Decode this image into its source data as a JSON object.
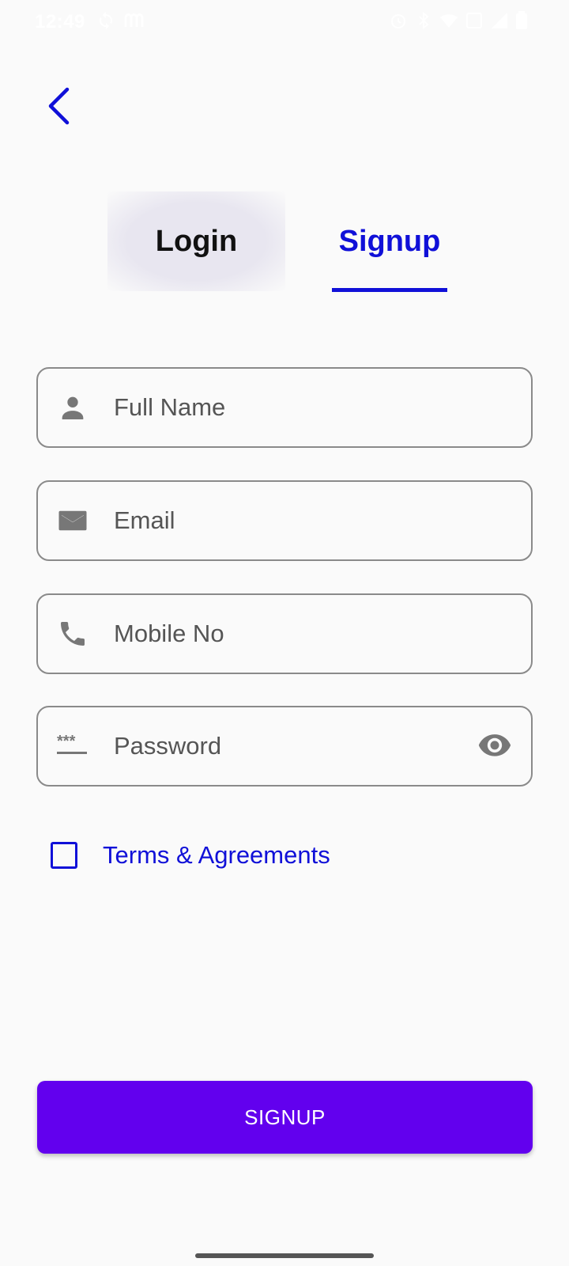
{
  "status_bar": {
    "time": "12:49",
    "left_icons": [
      "sync-icon",
      "messenger-icon"
    ],
    "right_icons": [
      "alarm-icon",
      "bluetooth-icon",
      "wifi-icon",
      "data-icon",
      "signal-icon",
      "battery-icon"
    ]
  },
  "navigation": {
    "back_icon": "chevron-left-icon"
  },
  "tabs": {
    "login_label": "Login",
    "signup_label": "Signup",
    "active": "Signup"
  },
  "form": {
    "full_name": {
      "placeholder": "Full Name",
      "value": "",
      "icon": "person-icon"
    },
    "email": {
      "placeholder": "Email",
      "value": "",
      "icon": "mail-icon"
    },
    "mobile": {
      "placeholder": "Mobile No",
      "value": "",
      "icon": "phone-icon"
    },
    "password": {
      "placeholder": "Password",
      "value": "",
      "icon": "password-icon",
      "toggle_icon": "eye-icon"
    }
  },
  "terms": {
    "label": "Terms & Agreements",
    "checked": false
  },
  "submit": {
    "label": "SIGNUP"
  },
  "colors": {
    "accent": "#1010d8",
    "button": "#6200ee",
    "background": "#fafafa",
    "border": "#8a8a8a",
    "icon": "#777777"
  }
}
